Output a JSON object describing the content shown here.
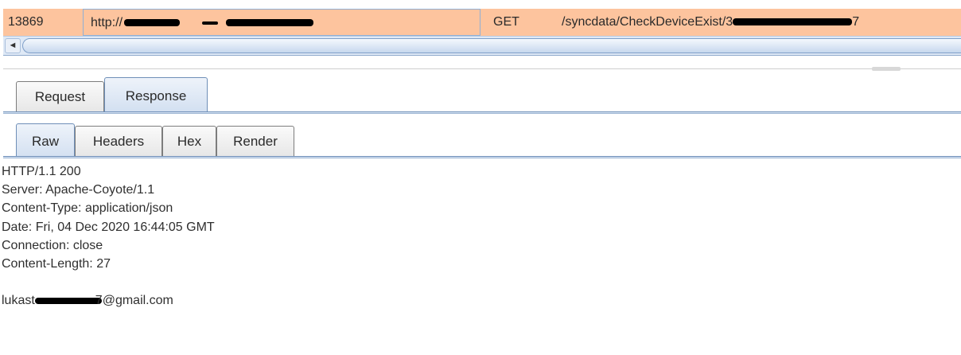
{
  "history_row": {
    "id": "13869",
    "host_prefix": "http://",
    "method": "GET",
    "path_prefix": "/syncdata/CheckDeviceExist/3",
    "path_suffix": "7",
    "row_color": "#fdc49e"
  },
  "scrollbar": {
    "left_arrow_icon": "arrow-left-icon",
    "left_arrow_glyph": "◄"
  },
  "message_tabs": [
    {
      "label": "Request",
      "active": false
    },
    {
      "label": "Response",
      "active": true
    }
  ],
  "view_tabs": [
    {
      "label": "Raw",
      "active": true
    },
    {
      "label": "Headers",
      "active": false
    },
    {
      "label": "Hex",
      "active": false
    },
    {
      "label": "Render",
      "active": false
    }
  ],
  "response": {
    "status_line": "HTTP/1.1 200",
    "headers": [
      "Server: Apache-Coyote/1.1",
      "Content-Type: application/json",
      "Date: Fri, 04 Dec 2020 16:44:05 GMT",
      "Connection: close",
      "Content-Length: 27"
    ],
    "body_prefix": "lukast",
    "body_mid": "7",
    "body_suffix": "@gmail.com"
  },
  "colors": {
    "accent_blue": "#6f8fb8",
    "active_tab": "#d3e0f1",
    "redaction": "#000000"
  }
}
